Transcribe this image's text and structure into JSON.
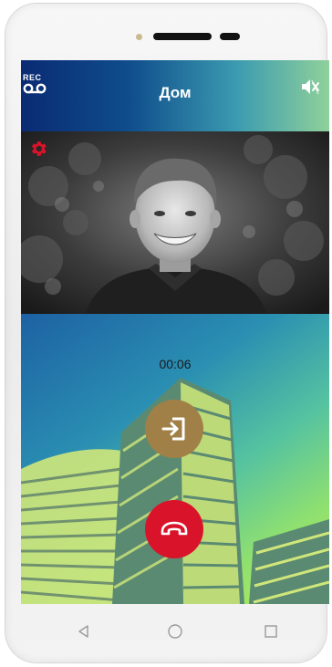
{
  "header": {
    "rec_label": "REC",
    "title": "Дом"
  },
  "call": {
    "timer": "00:06"
  },
  "icons": {
    "rec": "voicemail-icon",
    "mute": "speaker-muted-icon",
    "settings": "gear-icon",
    "enter": "door-enter-icon",
    "hangup": "phone-hangup-icon",
    "nav_back": "triangle-back-icon",
    "nav_home": "circle-home-icon",
    "nav_recent": "square-recent-icon"
  },
  "colors": {
    "enter_button": "#a08046",
    "hangup_button": "#d9142a",
    "settings_icon": "#d9142a",
    "header_gradient_start": "#0a2b73",
    "header_gradient_end": "#8fd19a"
  }
}
